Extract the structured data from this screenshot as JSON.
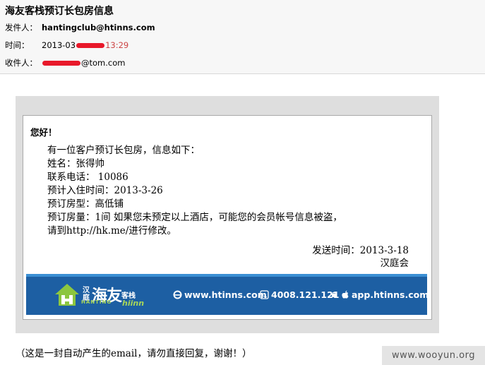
{
  "email": {
    "subject": "海友客栈预订长包房信息",
    "from_label": "发件人：",
    "from_value": "hantingclub@htinns.com",
    "time_label": "时间：",
    "time_value_start": "2013-03",
    "time_value_end": "13:29",
    "to_label": "收件人：",
    "to_value_end": "@tom.com"
  },
  "body": {
    "greeting": "您好！",
    "lines": [
      "有一位客户预订长包房，信息如下：",
      "姓名：张得帅",
      "联系电话： 10086",
      "预计入住时间：2013-3-26",
      "预订房型：高低铺",
      "预订房量：1间 如果您未预定以上酒店，可能您的会员帐号信息被盗，",
      "请到http://hk.me/进行修改。"
    ],
    "send_time": "发送时间：2013-3-18",
    "signature": "汉庭会"
  },
  "banner": {
    "logo_prefix": "汉庭",
    "logo_main": "海友",
    "logo_suffix": "客栈",
    "logo_en": "HANTING",
    "logo_script": "hiinn",
    "website": "www.htinns.com",
    "phone": "4008.121.121",
    "app": "app.htinns.com",
    "bg_color": "#1d5fa3"
  },
  "footer_note": "（这是一封自动产生的email，请勿直接回复，谢谢！）",
  "watermark": "www.wooyun.org",
  "redaction_color": "#e8182a"
}
